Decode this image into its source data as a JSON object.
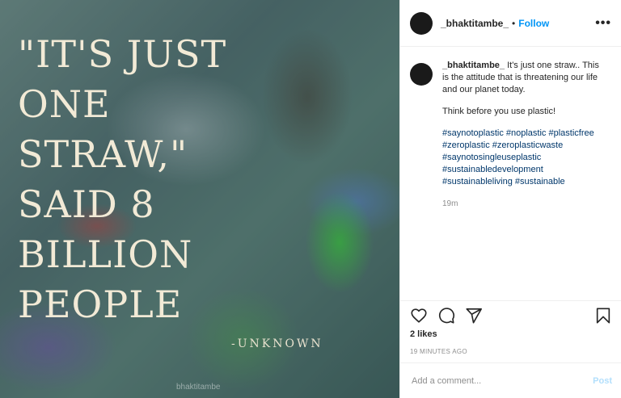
{
  "media": {
    "quote_lines": [
      "\"IT'S JUST",
      "ONE",
      "STRAW,\"",
      "SAID 8",
      "BILLION",
      "PEOPLE"
    ],
    "attribution": "-UNKNOWN",
    "watermark": "bhaktitambe"
  },
  "header": {
    "username": "_bhaktitambe_",
    "separator": "•",
    "follow_label": "Follow",
    "more_label": "•••"
  },
  "caption": {
    "username": "_bhaktitambe_",
    "text1": "It's just one straw.. This is the attitude that is threatening our life and our planet today.",
    "text2": "Think before you use plastic!",
    "tags": {
      "t1": "#saynotoplastic",
      "t2": "#noplastic",
      "t3": "#plasticfree",
      "t4": "#zeroplastic",
      "t5": "#zeroplasticwaste",
      "t6": "#saynotosingleuseplastic",
      "t7": "#sustainabledevelopment",
      "t8": "#sustainableliving",
      "t9": "#sustainable"
    },
    "time": "19m"
  },
  "actions": {
    "icons": [
      "heart-icon",
      "comment-icon",
      "share-icon",
      "bookmark-icon"
    ]
  },
  "likes": "2 likes",
  "timestamp": "19 MINUTES AGO",
  "comment": {
    "placeholder": "Add a comment...",
    "post_label": "Post"
  },
  "colors": {
    "link_blue": "#0095f6",
    "hashtag": "#00376b",
    "muted": "#8e8e8e",
    "post_disabled": "#b2dffc",
    "quote_text": "#f2ead6"
  }
}
